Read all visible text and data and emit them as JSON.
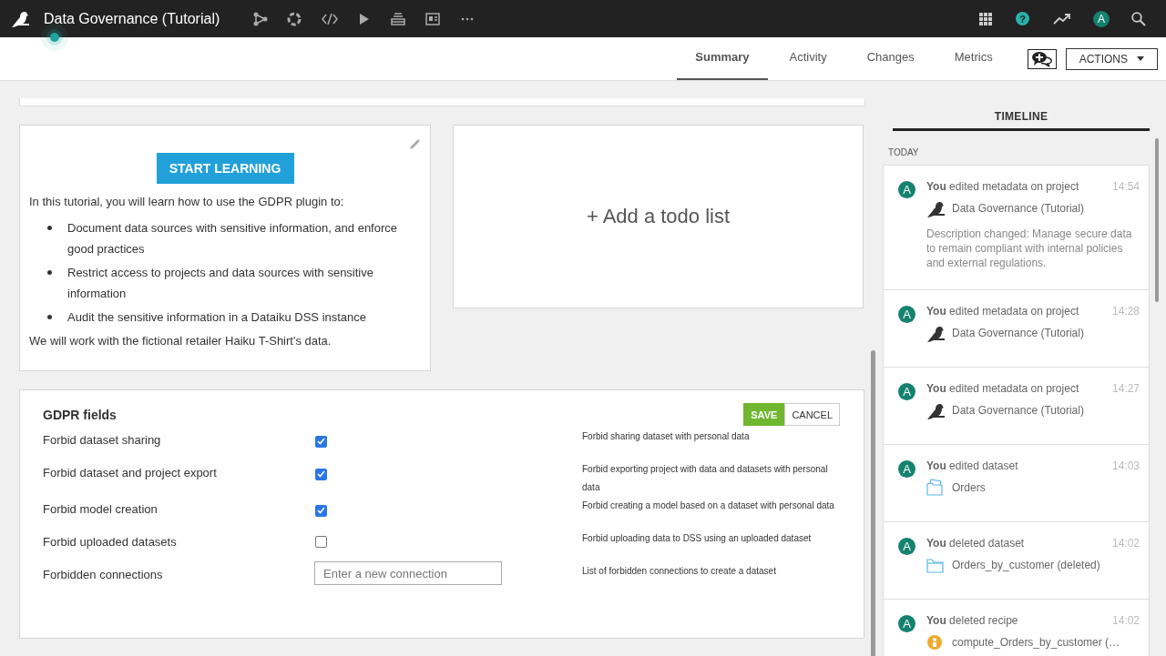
{
  "topbar": {
    "project_title": "Data Governance (Tutorial)",
    "help_label": "?",
    "avatar_letter": "A"
  },
  "nav": {
    "tabs": [
      {
        "label": "Summary",
        "selected": true
      },
      {
        "label": "Activity",
        "selected": false
      },
      {
        "label": "Changes",
        "selected": false
      },
      {
        "label": "Metrics",
        "selected": false
      }
    ],
    "actions_label": "ACTIONS"
  },
  "tutorial": {
    "button": "START LEARNING",
    "intro": "In this tutorial, you will learn how to use the GDPR plugin to:",
    "bullets": [
      "Document data sources with sensitive information, and enforce good practices",
      "Restrict access to projects and data sources with sensitive information",
      "Audit the sensitive information in a Dataiku DSS instance"
    ],
    "outro": "We will work with the fictional retailer Haiku T-Shirt's data."
  },
  "todo": {
    "label": "+ Add a todo list"
  },
  "gdpr": {
    "title": "GDPR fields",
    "save": "SAVE",
    "cancel": "CANCEL",
    "fields": [
      {
        "kind": "checkbox",
        "label": "Forbid dataset sharing",
        "checked": true,
        "help": "Forbid sharing dataset with personal data"
      },
      {
        "kind": "checkbox",
        "label": "Forbid dataset and project export",
        "checked": true,
        "help": "Forbid exporting project with data and datasets with personal data"
      },
      {
        "kind": "checkbox",
        "label": "Forbid model creation",
        "checked": true,
        "help": "Forbid creating a model based on a dataset with personal data"
      },
      {
        "kind": "checkbox",
        "label": "Forbid uploaded datasets",
        "checked": false,
        "help": "Forbid uploading data to DSS using an uploaded dataset"
      },
      {
        "kind": "text",
        "label": "Forbidden connections",
        "placeholder": "Enter a new connection",
        "help": "List of forbidden connections to create a dataset"
      }
    ]
  },
  "timeline": {
    "title": "TIMELINE",
    "group": "TODAY",
    "items": [
      {
        "avatar": "A",
        "action": "**You** edited metadata on project",
        "time": "14:54",
        "kind": "project",
        "object": "Data Governance (Tutorial)",
        "description": "Description changed: Manage secure data to remain compliant with internal policies and external regulations."
      },
      {
        "avatar": "A",
        "action": "**You** edited metadata on project",
        "time": "14:28",
        "kind": "project",
        "object": "Data Governance (Tutorial)"
      },
      {
        "avatar": "A",
        "action": "**You** edited metadata on project",
        "time": "14:27",
        "kind": "project",
        "object": "Data Governance (Tutorial)"
      },
      {
        "avatar": "A",
        "action": "**You** edited dataset",
        "time": "14:03",
        "kind": "dataset",
        "object": "Orders"
      },
      {
        "avatar": "A",
        "action": "**You** deleted dataset",
        "time": "14:02",
        "kind": "deleted-dataset",
        "object": "Orders_by_customer (deleted)"
      },
      {
        "avatar": "A",
        "action": "**You** deleted recipe",
        "time": "14:02",
        "kind": "recipe",
        "object": "compute_Orders_by_customer (…"
      }
    ]
  }
}
